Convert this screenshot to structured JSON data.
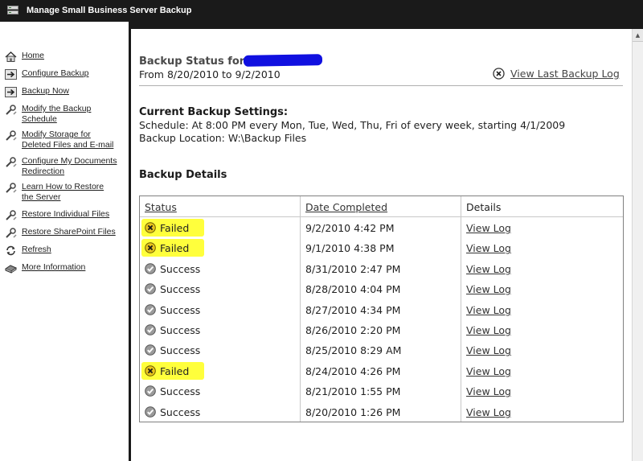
{
  "window": {
    "title": "Manage Small Business Server Backup"
  },
  "nav": {
    "items": [
      {
        "label": "Home",
        "icon": "home-icon"
      },
      {
        "label": "Configure Backup",
        "icon": "arrow-icon"
      },
      {
        "label": "Backup Now",
        "icon": "arrow-icon"
      },
      {
        "label_line1": "Modify the Backup",
        "label_line2": "Schedule",
        "icon": "wrench-icon"
      },
      {
        "label_line1": "Modify Storage for",
        "label_line2": "Deleted Files and E-mail",
        "icon": "wrench-icon"
      },
      {
        "label_line1": "Configure My Documents",
        "label_line2": "Redirection",
        "icon": "wrench-icon"
      },
      {
        "label_line1": "Learn How to Restore",
        "label_line2": "the Server",
        "icon": "wrench-icon"
      },
      {
        "label": "Restore Individual Files",
        "icon": "wrench-icon"
      },
      {
        "label": "Restore SharePoint Files",
        "icon": "wrench-icon"
      },
      {
        "label": "Refresh",
        "icon": "refresh-icon"
      },
      {
        "label": "More Information",
        "icon": "book-icon"
      }
    ]
  },
  "status": {
    "title": "Backup Status for",
    "date_range": "From 8/20/2010 to 9/2/2010",
    "view_last_log": "View Last Backup Log"
  },
  "settings": {
    "title": "Current Backup Settings:",
    "schedule": "Schedule: At 8:00 PM every Mon, Tue, Wed, Thu, Fri of every week, starting 4/1/2009",
    "location": "Backup Location: W:\\Backup Files"
  },
  "details": {
    "title": "Backup Details",
    "headers": {
      "status": "Status",
      "date": "Date Completed",
      "details": "Details"
    },
    "rows": [
      {
        "status": "Failed",
        "date": "9/2/2010 4:42 PM",
        "link": "View Log"
      },
      {
        "status": "Failed",
        "date": "9/1/2010 4:38 PM",
        "link": "View Log"
      },
      {
        "status": "Success",
        "date": "8/31/2010 2:47 PM",
        "link": "View Log"
      },
      {
        "status": "Success",
        "date": "8/28/2010 4:04 PM",
        "link": "View Log"
      },
      {
        "status": "Success",
        "date": "8/27/2010 4:34 PM",
        "link": "View Log"
      },
      {
        "status": "Success",
        "date": "8/26/2010 2:20 PM",
        "link": "View Log"
      },
      {
        "status": "Success",
        "date": "8/25/2010 8:29 AM",
        "link": "View Log"
      },
      {
        "status": "Failed",
        "date": "8/24/2010 4:26 PM",
        "link": "View Log"
      },
      {
        "status": "Success",
        "date": "8/21/2010 1:55 PM",
        "link": "View Log"
      },
      {
        "status": "Success",
        "date": "8/20/2010 1:26 PM",
        "link": "View Log"
      }
    ]
  },
  "colors": {
    "highlight": "#ffff3c",
    "redaction": "#1010e0",
    "titlebar": "#1a1a1a"
  }
}
